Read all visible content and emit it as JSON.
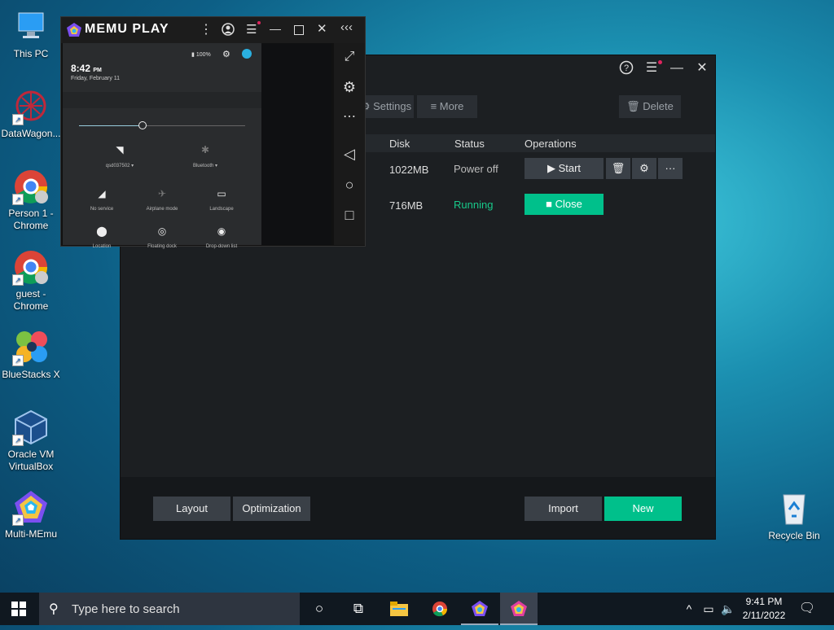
{
  "desktop": {
    "icons": [
      {
        "label": "This PC"
      },
      {
        "label": "DataWagon..."
      },
      {
        "label": "Person 1 -\nChrome"
      },
      {
        "label": "guest -\nChrome"
      },
      {
        "label": "BlueStacks X"
      },
      {
        "label": "Oracle VM\nVirtualBox"
      },
      {
        "label": "Multi-MEmu"
      },
      {
        "label": "Recycle Bin"
      }
    ]
  },
  "multi_memu": {
    "toolbar": {
      "settings": "Settings",
      "more": "More",
      "delete": "Delete"
    },
    "columns": [
      "Disk",
      "Status",
      "Operations"
    ],
    "rows": [
      {
        "disk": "1022MB",
        "status": "Power off",
        "action": "Start"
      },
      {
        "disk": "716MB",
        "status": "Running",
        "action": "Close"
      }
    ],
    "footer": {
      "layout": "Layout",
      "optimization": "Optimization",
      "import": "Import",
      "new": "New"
    },
    "colors": {
      "accent": "#00c08b",
      "running": "#18c98a"
    }
  },
  "memu_play": {
    "title": "MEMU PLAY",
    "status_bar": {
      "battery": "100%"
    },
    "time": "8:42",
    "ampm": "PM",
    "date": "Friday, February 11",
    "brightness": 0.38,
    "quick_settings": {
      "wifi": "qsd037502",
      "bluetooth": "Bluetooth",
      "tiles": [
        "No service",
        "Airplane mode",
        "Landscape",
        "Location",
        "Floating dock",
        "Drop-down list"
      ]
    }
  },
  "taskbar": {
    "search_placeholder": "Type here to search",
    "time": "9:41 PM",
    "date": "2/11/2022"
  }
}
